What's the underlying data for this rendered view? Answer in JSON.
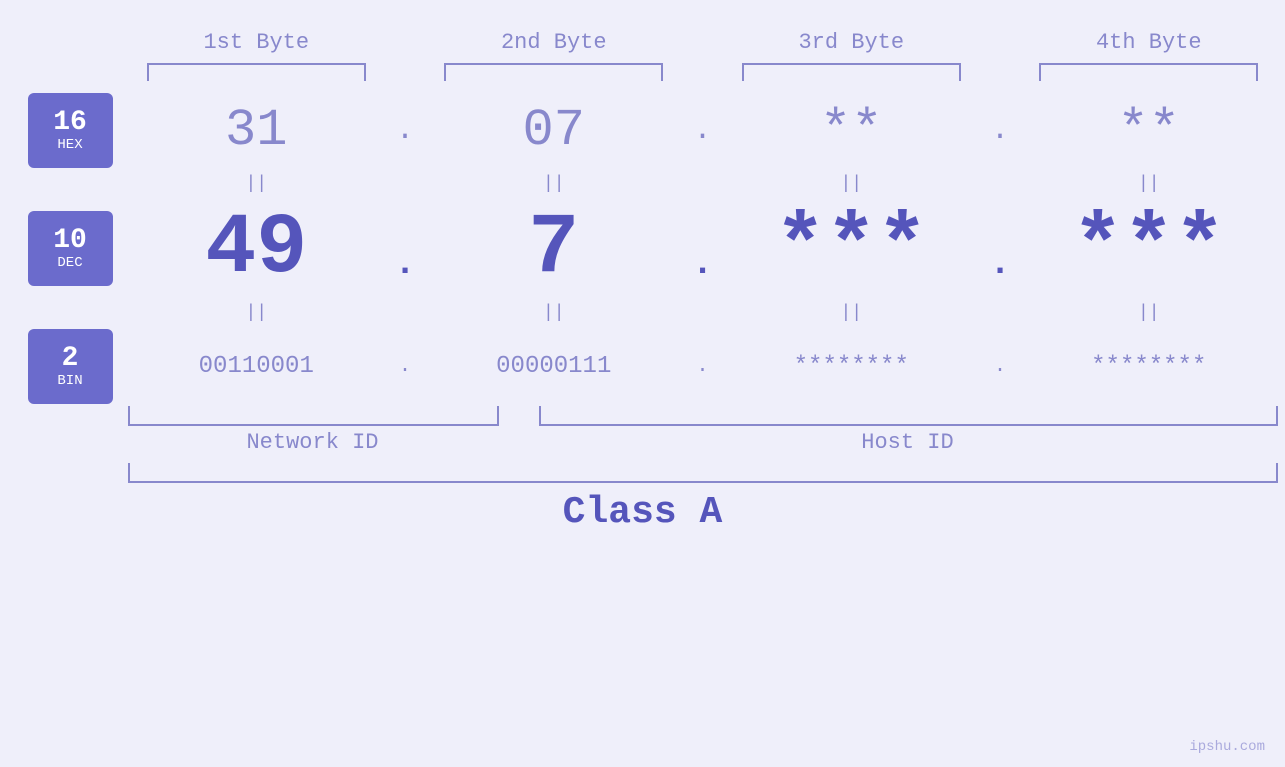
{
  "page": {
    "background_color": "#efeffa"
  },
  "headers": {
    "byte1": "1st Byte",
    "byte2": "2nd Byte",
    "byte3": "3rd Byte",
    "byte4": "4th Byte"
  },
  "bases": {
    "hex": {
      "number": "16",
      "name": "HEX"
    },
    "dec": {
      "number": "10",
      "name": "DEC"
    },
    "bin": {
      "number": "2",
      "name": "BIN"
    }
  },
  "hex_row": {
    "b1": "31",
    "b2": "07",
    "b3": "**",
    "b4": "**",
    "sep": "."
  },
  "dec_row": {
    "b1": "49",
    "b2": "7",
    "b3": "***",
    "b4": "***",
    "sep": "."
  },
  "bin_row": {
    "b1": "00110001",
    "b2": "00000111",
    "b3": "********",
    "b4": "********",
    "sep": "."
  },
  "labels": {
    "network_id": "Network ID",
    "host_id": "Host ID",
    "class": "Class A"
  },
  "equals": {
    "symbol": "||"
  },
  "attribution": "ipshu.com"
}
